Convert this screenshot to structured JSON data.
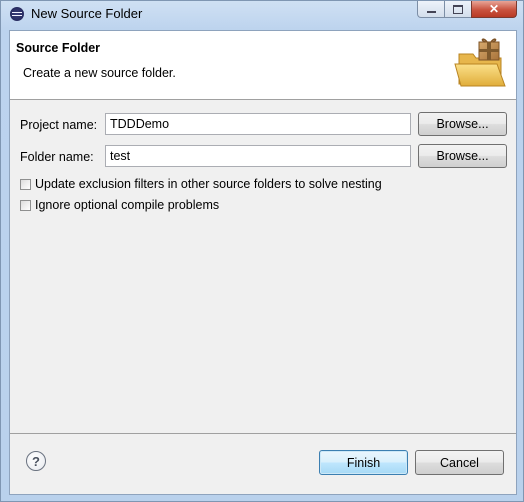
{
  "window": {
    "title": "New Source Folder",
    "close_glyph": "✕"
  },
  "banner": {
    "title": "Source Folder",
    "message": "Create a new source folder.",
    "icon": "new-source-folder-icon"
  },
  "form": {
    "project_label": "Project name:",
    "project_value": "TDDDemo",
    "folder_label": "Folder name:",
    "folder_value": "test",
    "browse_label": "Browse...",
    "checkboxes": [
      {
        "label": "Update exclusion filters in other source folders to solve nesting",
        "checked": false
      },
      {
        "label": "Ignore optional compile problems",
        "checked": false
      }
    ]
  },
  "footer": {
    "help_glyph": "?",
    "finish_label": "Finish",
    "cancel_label": "Cancel"
  },
  "colors": {
    "finish_button_border": "#3c7fb1",
    "frame": "#bcd3ee",
    "close_button": "#c9533f"
  }
}
